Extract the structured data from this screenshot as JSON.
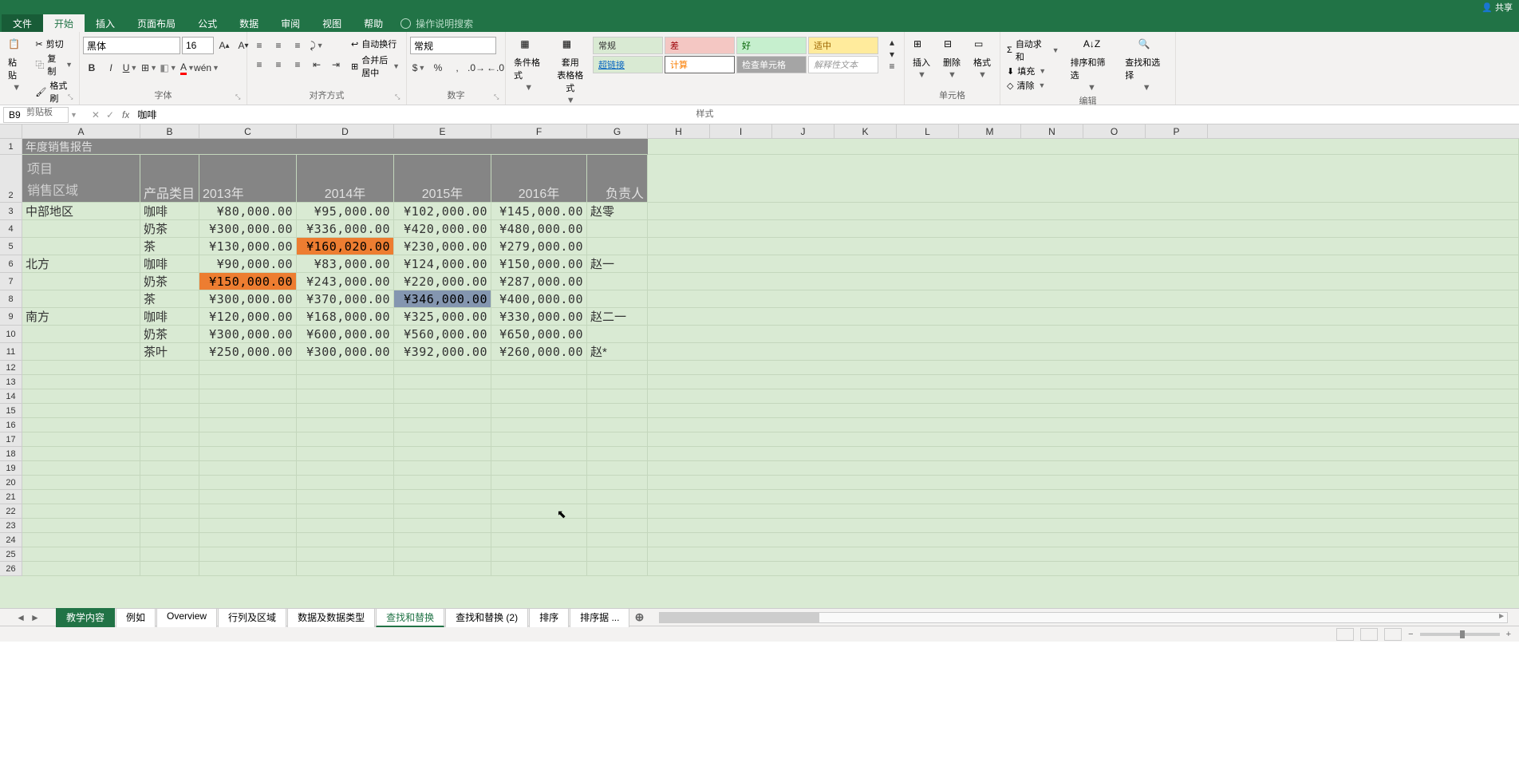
{
  "share": "共享",
  "tabs": {
    "file": "文件",
    "home": "开始",
    "insert": "插入",
    "layout": "页面布局",
    "formula": "公式",
    "data": "数据",
    "review": "审阅",
    "view": "视图",
    "help": "帮助",
    "tellme": "操作说明搜索"
  },
  "ribbon": {
    "clipboard": {
      "paste": "粘贴",
      "cut": "剪切",
      "copy": "复制",
      "painter": "格式刷",
      "label": "剪贴板"
    },
    "font": {
      "name": "黑体",
      "size": "16",
      "label": "字体"
    },
    "align": {
      "wrap": "自动换行",
      "merge": "合并后居中",
      "label": "对齐方式"
    },
    "number": {
      "format": "常规",
      "label": "数字"
    },
    "styles": {
      "cond": "条件格式",
      "table": "套用\n表格格式",
      "normal": "常规",
      "bad": "差",
      "good": "好",
      "neutral": "适中",
      "link": "超链接",
      "calc": "计算",
      "check": "检查单元格",
      "explain": "解释性文本",
      "label": "样式"
    },
    "cells": {
      "insert": "插入",
      "delete": "删除",
      "format": "格式",
      "label": "单元格"
    },
    "editing": {
      "autosum": "自动求和",
      "fill": "填充",
      "clear": "清除",
      "sort": "排序和筛选",
      "find": "查找和选择",
      "label": "编辑"
    }
  },
  "namebox": "B9",
  "formula_value": "咖啡",
  "cols": [
    "A",
    "B",
    "C",
    "D",
    "E",
    "F",
    "G",
    "H",
    "I",
    "J",
    "K",
    "L",
    "M",
    "N",
    "O",
    "P"
  ],
  "title": "年度销售报告",
  "hdr": {
    "proj": "项目",
    "region": "销售区域",
    "cat": "产品类目",
    "y13": "2013年",
    "y14": "2014年",
    "y15": "2015年",
    "y16": "2016年",
    "owner": "负责人"
  },
  "rows": [
    {
      "region": "中部地区",
      "cat": "咖啡",
      "c": "¥80,000.00",
      "d": "¥95,000.00",
      "e": "¥102,000.00",
      "f": "¥145,000.00",
      "g": "赵零"
    },
    {
      "region": "",
      "cat": "奶茶",
      "c": "¥300,000.00",
      "d": "¥336,000.00",
      "e": "¥420,000.00",
      "f": "¥480,000.00",
      "g": ""
    },
    {
      "region": "",
      "cat": "茶",
      "c": "¥130,000.00",
      "d": "¥160,020.00",
      "e": "¥230,000.00",
      "f": "¥279,000.00",
      "g": "",
      "hl_d": true
    },
    {
      "region": "北方",
      "cat": "咖啡",
      "c": "¥90,000.00",
      "d": "¥83,000.00",
      "e": "¥124,000.00",
      "f": "¥150,000.00",
      "g": "赵一"
    },
    {
      "region": "",
      "cat": "奶茶",
      "c": "¥150,000.00",
      "d": "¥243,000.00",
      "e": "¥220,000.00",
      "f": "¥287,000.00",
      "g": "",
      "hl_c": true
    },
    {
      "region": "",
      "cat": "茶",
      "c": "¥300,000.00",
      "d": "¥370,000.00",
      "e": "¥346,000.00",
      "f": "¥400,000.00",
      "g": "",
      "hl_e_grey": true
    },
    {
      "region": "南方",
      "cat": "咖啡",
      "c": "¥120,000.00",
      "d": "¥168,000.00",
      "e": "¥325,000.00",
      "f": "¥330,000.00",
      "g": "赵二一"
    },
    {
      "region": "",
      "cat": "奶茶",
      "c": "¥300,000.00",
      "d": "¥600,000.00",
      "e": "¥560,000.00",
      "f": "¥650,000.00",
      "g": ""
    },
    {
      "region": "",
      "cat": "茶叶",
      "c": "¥250,000.00",
      "d": "¥300,000.00",
      "e": "¥392,000.00",
      "f": "¥260,000.00",
      "g": "赵*"
    }
  ],
  "sheets": [
    "教学内容",
    "例如",
    "Overview",
    "行列及区域",
    "数据及数据类型",
    "查找和替换",
    "查找和替换 (2)",
    "排序",
    "排序据 ..."
  ],
  "active_sheet": 0,
  "sel_sheet": 5,
  "zoom_minus": "−",
  "zoom_plus": "+"
}
